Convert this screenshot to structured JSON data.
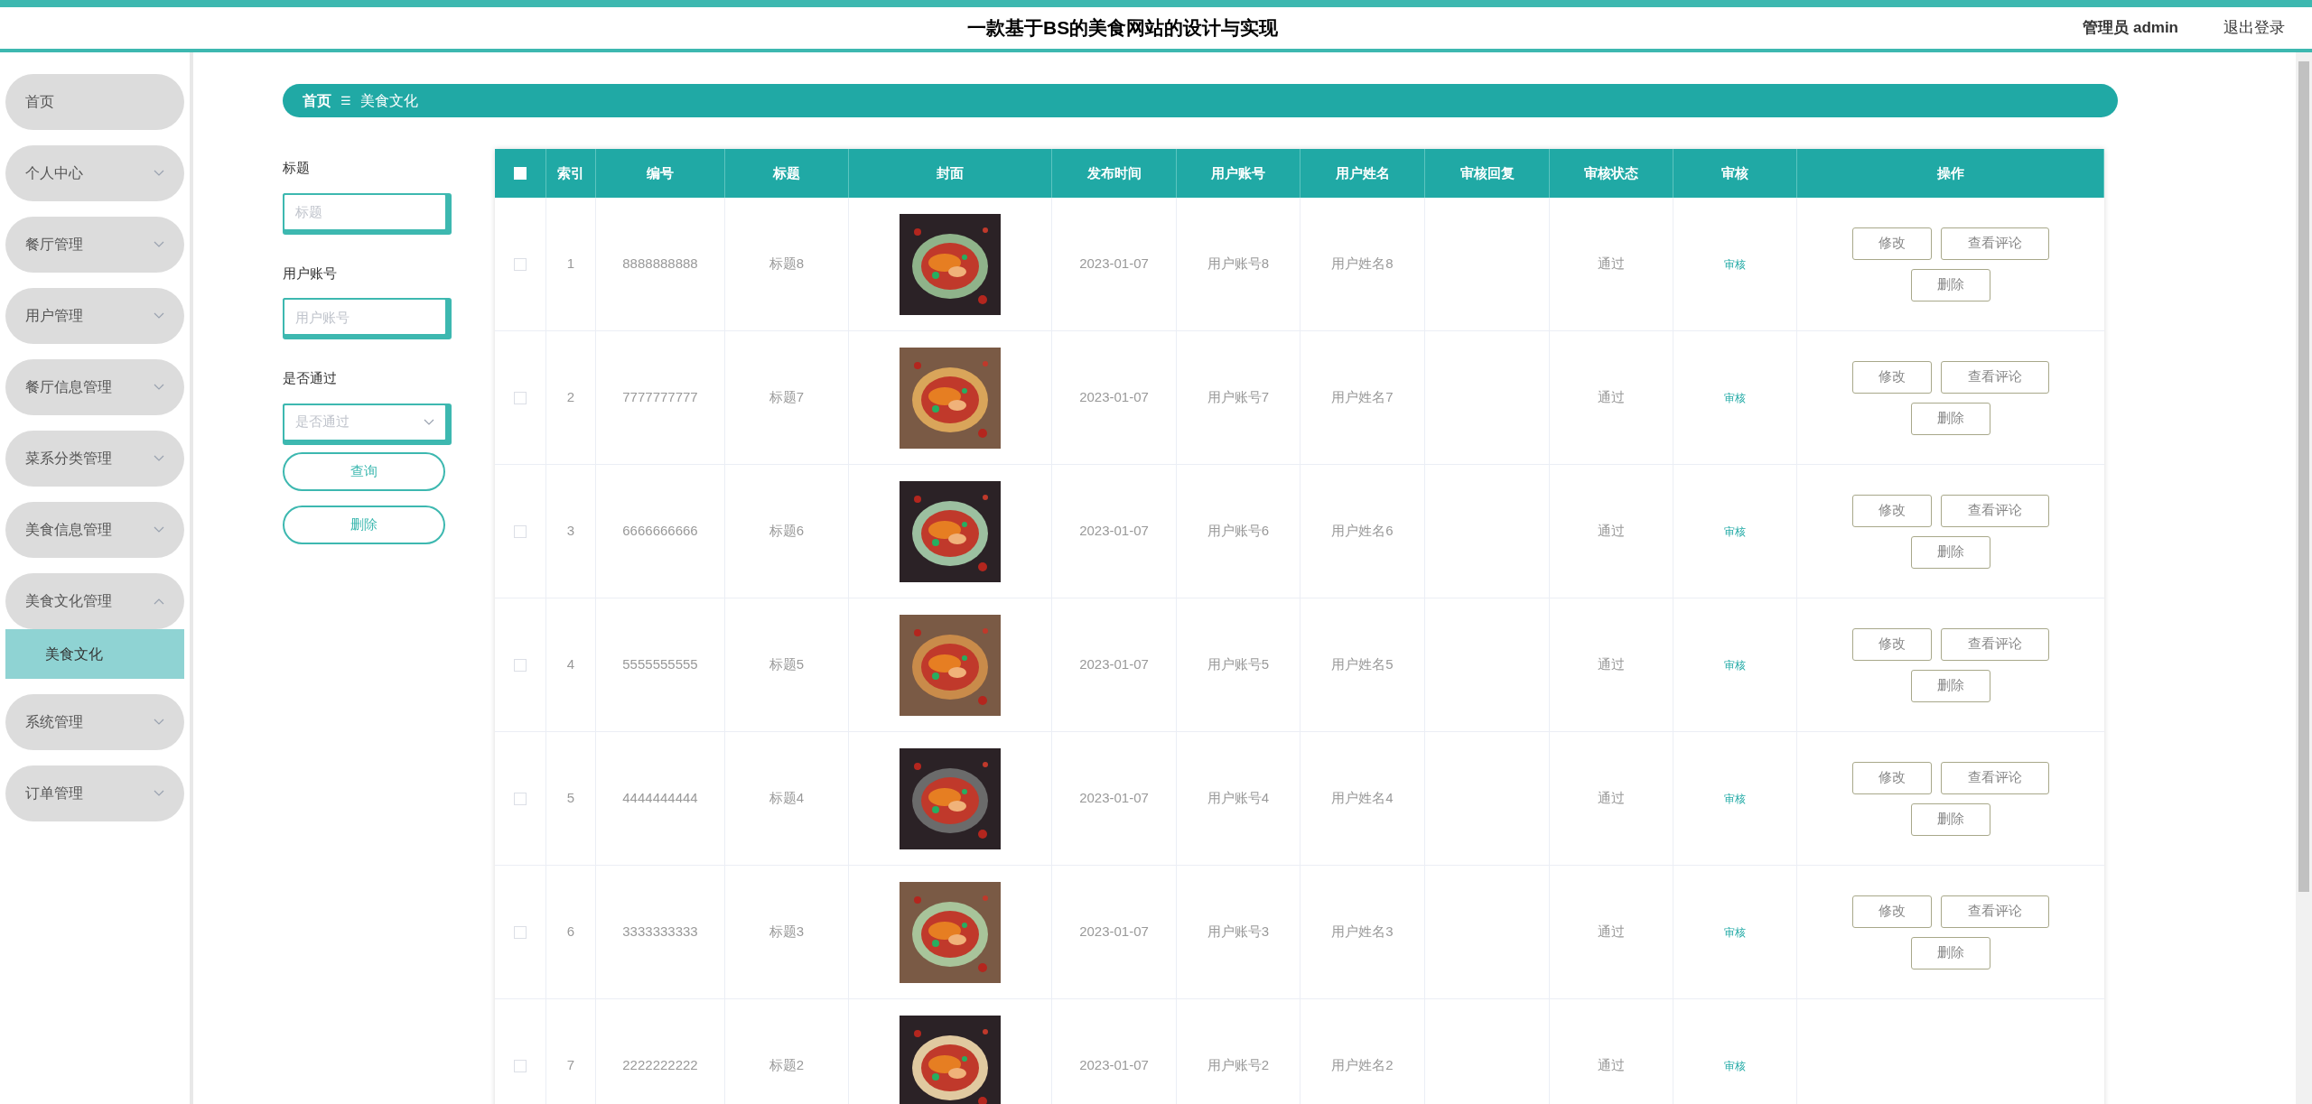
{
  "header": {
    "title": "一款基于BS的美食网站的设计与实现",
    "user": "管理员 admin",
    "logout": "退出登录"
  },
  "sidebar": {
    "items": [
      {
        "label": "首页",
        "kind": "link"
      },
      {
        "label": "个人中心",
        "kind": "menu",
        "expanded": false
      },
      {
        "label": "餐厅管理",
        "kind": "menu",
        "expanded": false
      },
      {
        "label": "用户管理",
        "kind": "menu",
        "expanded": false
      },
      {
        "label": "餐厅信息管理",
        "kind": "menu",
        "expanded": false
      },
      {
        "label": "菜系分类管理",
        "kind": "menu",
        "expanded": false
      },
      {
        "label": "美食信息管理",
        "kind": "menu",
        "expanded": false
      },
      {
        "label": "美食文化管理",
        "kind": "menu",
        "expanded": true,
        "children": [
          {
            "label": "美食文化",
            "selected": true
          }
        ]
      },
      {
        "label": "系统管理",
        "kind": "menu",
        "expanded": false
      },
      {
        "label": "订单管理",
        "kind": "menu",
        "expanded": false
      }
    ]
  },
  "breadcrumb": {
    "home": "首页",
    "separator": "☰",
    "current": "美食文化"
  },
  "filters": [
    {
      "label": "标题",
      "kind": "text",
      "placeholder": "标题"
    },
    {
      "label": "用户账号",
      "kind": "text",
      "placeholder": "用户账号"
    },
    {
      "label": "是否通过",
      "kind": "select",
      "placeholder": "是否通过"
    }
  ],
  "filter_buttons": [
    "查询",
    "删除"
  ],
  "table": {
    "select_all_checked": false,
    "columns": [
      "索引",
      "编号",
      "标题",
      "封面",
      "发布时间",
      "用户账号",
      "用户姓名",
      "审核回复",
      "审核状态",
      "审核",
      "操作"
    ],
    "rows": [
      {
        "checked": false,
        "index": "1",
        "number": "8888888888",
        "title": "标题8",
        "cover": {
          "kind": "picture"
        },
        "date": "2023-01-07",
        "account": "用户账号8",
        "name": "用户姓名8",
        "status": "通过",
        "review": "审核",
        "actions": [
          "修改",
          "查看评论",
          "删除"
        ]
      },
      {
        "checked": false,
        "index": "2",
        "number": "7777777777",
        "title": "标题7",
        "cover": {
          "kind": "picture"
        },
        "date": "2023-01-07",
        "account": "用户账号7",
        "name": "用户姓名7",
        "status": "通过",
        "review": "审核",
        "actions": [
          "修改",
          "查看评论",
          "删除"
        ]
      },
      {
        "checked": false,
        "index": "3",
        "number": "6666666666",
        "title": "标题6",
        "cover": {
          "kind": "picture"
        },
        "date": "2023-01-07",
        "account": "用户账号6",
        "name": "用户姓名6",
        "status": "通过",
        "review": "审核",
        "actions": [
          "修改",
          "查看评论",
          "删除"
        ]
      },
      {
        "checked": false,
        "index": "4",
        "number": "5555555555",
        "title": "标题5",
        "cover": {
          "kind": "picture"
        },
        "date": "2023-01-07",
        "account": "用户账号5",
        "name": "用户姓名5",
        "status": "通过",
        "review": "审核",
        "actions": [
          "修改",
          "查看评论",
          "删除"
        ]
      },
      {
        "checked": false,
        "index": "5",
        "number": "4444444444",
        "title": "标题4",
        "cover": {
          "kind": "picture"
        },
        "date": "2023-01-07",
        "account": "用户账号4",
        "name": "用户姓名4",
        "status": "通过",
        "review": "审核",
        "actions": [
          "修改",
          "查看评论",
          "删除"
        ]
      },
      {
        "checked": false,
        "index": "6",
        "number": "3333333333",
        "title": "标题3",
        "cover": {
          "kind": "picture"
        },
        "date": "2023-01-07",
        "account": "用户账号3",
        "name": "用户姓名3",
        "status": "通过",
        "review": "审核",
        "actions": [
          "修改",
          "查看评论",
          "删除"
        ]
      },
      {
        "checked": false,
        "index": "7",
        "number": "2222222222",
        "title": "标题2",
        "cover": {
          "kind": "picture"
        },
        "date": "2023-01-07",
        "account": "用户账号2",
        "name": "用户姓名2",
        "status": "通过",
        "review": "审核",
        "actions": []
      }
    ]
  }
}
